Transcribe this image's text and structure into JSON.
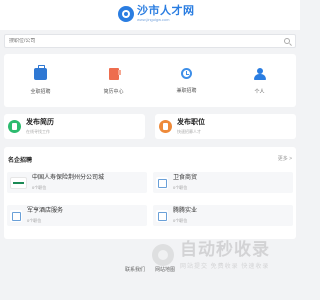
{
  "header": {
    "logo_title": "沙市人才网",
    "logo_sub": "www.jinguigw.com"
  },
  "search": {
    "placeholder": "搜职位/公司"
  },
  "quick": [
    {
      "label": "全职招聘"
    },
    {
      "label": "简历中心"
    },
    {
      "label": "兼职招聘"
    },
    {
      "label": "个人"
    }
  ],
  "publish": {
    "resume_title": "发布简历",
    "resume_sub": "在线寻找工作",
    "job_title": "发布职位",
    "job_sub": "快速招募人才"
  },
  "famous": {
    "title": "名企招聘",
    "more": "更多 >",
    "companies": [
      {
        "name": "中国人寿保险荆州分公司城",
        "jobs": "0个职位"
      },
      {
        "name": "卫食商贸",
        "jobs": "0个职位"
      },
      {
        "name": "军亨酒店服务",
        "jobs": "0个职位"
      },
      {
        "name": "腾腾实业",
        "jobs": "0个职位"
      }
    ]
  },
  "footer": {
    "links": [
      "联系我们",
      "网站地图"
    ]
  },
  "watermark": {
    "title": "自动秒收录",
    "sub": "网站提交 免费收录 快速收录"
  }
}
